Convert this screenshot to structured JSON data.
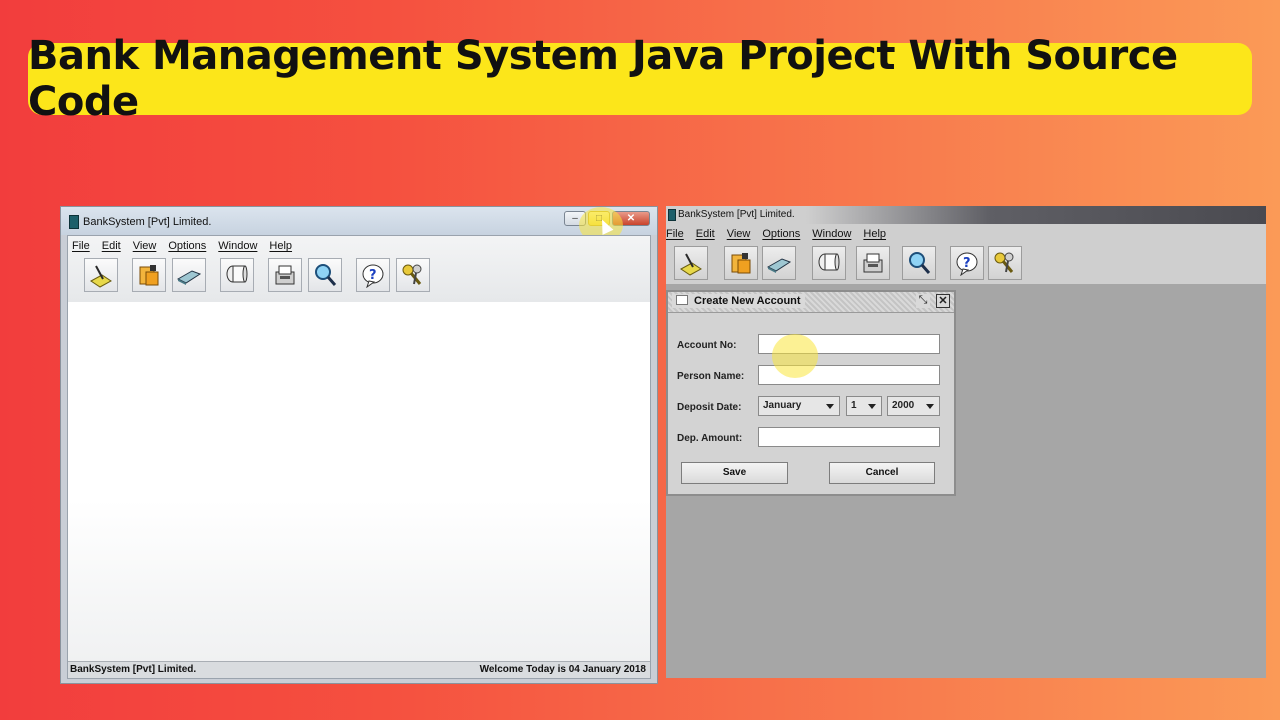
{
  "banner": {
    "title": "Bank Management System Java Project With Source Code"
  },
  "left_window": {
    "title": "BankSystem [Pvt] Limited.",
    "menu": [
      "File",
      "Edit",
      "View",
      "Options",
      "Window",
      "Help"
    ],
    "status_left": "BankSystem [Pvt] Limited.",
    "status_right": "Welcome Today is 04 January 2018",
    "window_buttons": {
      "minimize": "–",
      "maximize": "□",
      "close": "✕"
    }
  },
  "right_window": {
    "title": "BankSystem [Pvt] Limited.",
    "menu": [
      "File",
      "Edit",
      "View",
      "Options",
      "Window",
      "Help"
    ],
    "dialog": {
      "title": "Create New Account",
      "labels": {
        "account_no": "Account No:",
        "person_name": "Person Name:",
        "deposit_date": "Deposit Date:",
        "dep_amount": "Dep. Amount:"
      },
      "values": {
        "account_no": "",
        "person_name": "",
        "dep_amount": ""
      },
      "month": "January",
      "day": "1",
      "year": "2000",
      "save_label": "Save",
      "cancel_label": "Cancel",
      "restore_glyph": "⤡",
      "close_glyph": "✕"
    }
  },
  "toolbar_icons": [
    "new-account-icon",
    "deposit-icon",
    "withdraw-icon",
    "delete-account-icon",
    "print-icon",
    "search-icon",
    "help-icon",
    "logout-keys-icon"
  ],
  "colors": {
    "banner": "#fce61a",
    "bg_left": "#f23d3d",
    "bg_right": "#fb9a57",
    "highlight": "#fae63c"
  }
}
